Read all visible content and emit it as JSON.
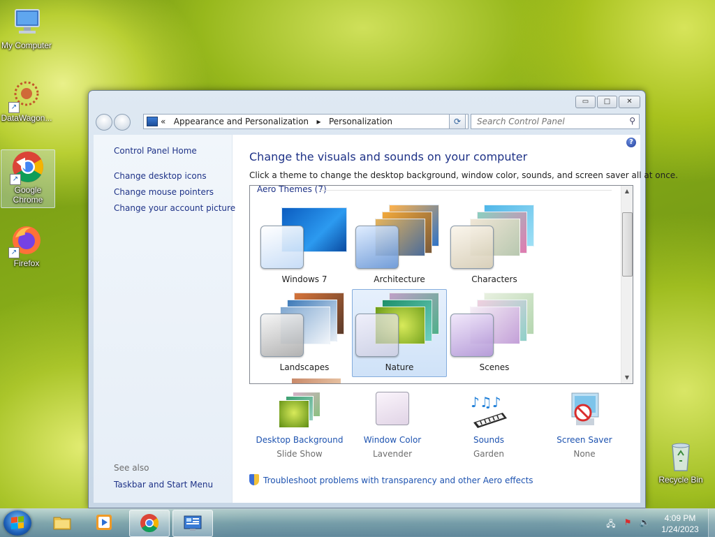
{
  "desktop": {
    "icons": [
      {
        "label": "My Computer"
      },
      {
        "label": "DataWagon..."
      },
      {
        "label": "Google Chrome"
      },
      {
        "label": "Firefox"
      },
      {
        "label": "Recycle Bin"
      }
    ]
  },
  "window": {
    "buttons": {
      "minimize": "▭",
      "maximize": "□",
      "close": "✕"
    },
    "address": {
      "overflow": "«",
      "crumb1": "Appearance and Personalization",
      "separator": "▸",
      "crumb2": "Personalization",
      "dropdown": "▼"
    },
    "refresh": "⟳",
    "search": {
      "placeholder": "Search Control Panel"
    },
    "left_links": [
      "Control Panel Home",
      "Change desktop icons",
      "Change mouse pointers",
      "Change your account picture"
    ],
    "see_also": {
      "title": "See also",
      "links": [
        "Taskbar and Start Menu"
      ]
    },
    "help": "?",
    "heading": "Change the visuals and sounds on your computer",
    "description": "Click a theme to change the desktop background, window color, sounds, and screen saver all at once.",
    "theme_group": "Aero Themes (7)",
    "themes": [
      {
        "name": "Windows 7",
        "selected": false
      },
      {
        "name": "Architecture",
        "selected": false
      },
      {
        "name": "Characters",
        "selected": false
      },
      {
        "name": "Landscapes",
        "selected": false
      },
      {
        "name": "Nature",
        "selected": true
      },
      {
        "name": "Scenes",
        "selected": false
      }
    ],
    "bottom": [
      {
        "title": "Desktop Background",
        "value": "Slide Show"
      },
      {
        "title": "Window Color",
        "value": "Lavender"
      },
      {
        "title": "Sounds",
        "value": "Garden"
      },
      {
        "title": "Screen Saver",
        "value": "None"
      }
    ],
    "troubleshoot": "Troubleshoot problems with transparency and other Aero effects"
  },
  "taskbar": {
    "clock": {
      "time": "4:09 PM",
      "date": "1/24/2023"
    }
  },
  "colors": {
    "link": "#1e3287",
    "accent": "#1e53b0",
    "selected_theme_border": "#84acdd"
  }
}
